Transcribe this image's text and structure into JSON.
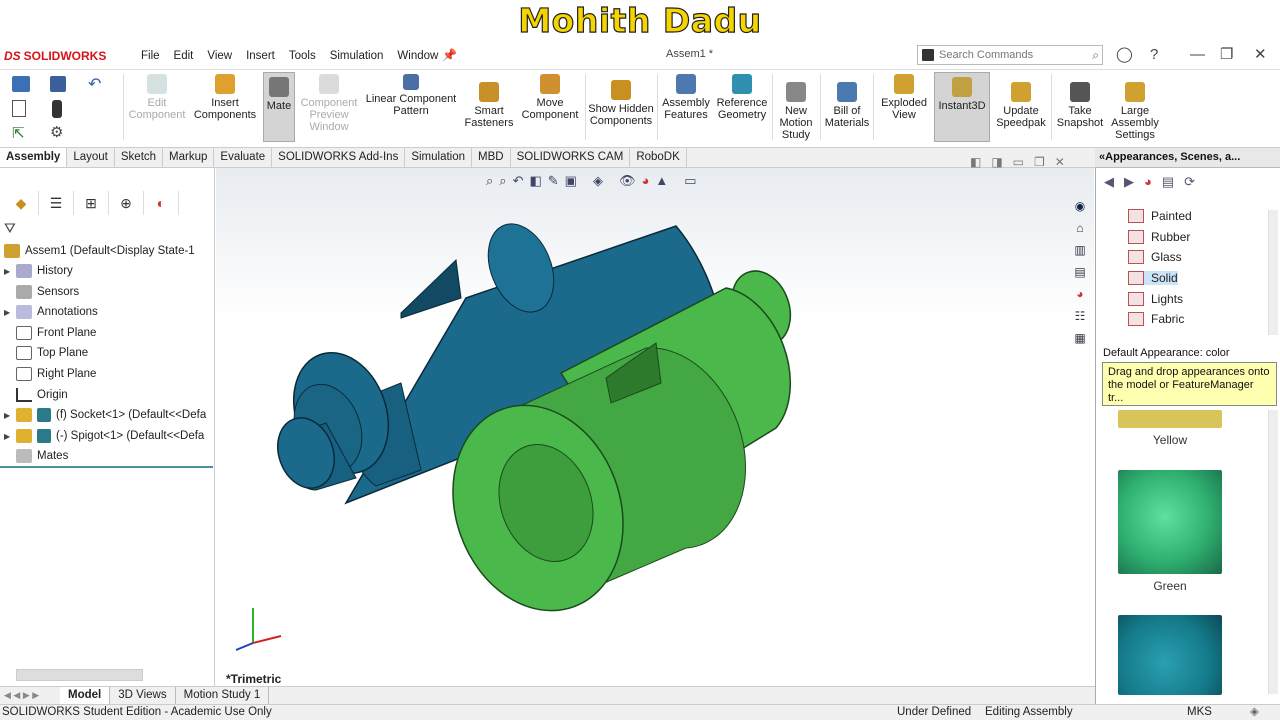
{
  "banner": {
    "text": "Mohith Dadu"
  },
  "app": {
    "logo_text": "SOLIDWORKS",
    "doc_title": "Assem1 *"
  },
  "menu": [
    "File",
    "Edit",
    "View",
    "Insert",
    "Tools",
    "Simulation",
    "Window"
  ],
  "search": {
    "placeholder": "Search Commands"
  },
  "ribbon": {
    "edit_component": "Edit Component",
    "insert_components": "Insert Components",
    "mate": "Mate",
    "component_preview": "Component Preview Window",
    "linear_pattern": "Linear Component Pattern",
    "smart_fasteners": "Smart Fasteners",
    "move_component": "Move Component",
    "show_hidden": "Show Hidden Components",
    "assembly_features": "Assembly Features",
    "reference_geometry": "Reference Geometry",
    "new_motion_study": "New Motion Study",
    "bill_of_materials": "Bill of Materials",
    "exploded_view": "Exploded View",
    "instant3d": "Instant3D",
    "update_speedpak": "Update Speedpak",
    "take_snapshot": "Take Snapshot",
    "large_assembly": "Large Assembly Settings"
  },
  "command_tabs": [
    "Assembly",
    "Layout",
    "Sketch",
    "Markup",
    "Evaluate",
    "SOLIDWORKS Add-Ins",
    "Simulation",
    "MBD",
    "SOLIDWORKS CAM",
    "RoboDK"
  ],
  "tree": {
    "root": "Assem1  (Default<Display State-1",
    "history": "History",
    "sensors": "Sensors",
    "annotations": "Annotations",
    "front_plane": "Front Plane",
    "top_plane": "Top Plane",
    "right_plane": "Right Plane",
    "origin": "Origin",
    "socket": "(f) Socket<1> (Default<<Defa",
    "spigot": "(-) Spigot<1> (Default<<Defa",
    "mates": "Mates"
  },
  "viewport": {
    "view_label": "*Trimetric"
  },
  "right_panel": {
    "header": "Appearances, Scenes, a...",
    "folders": [
      "Painted",
      "Rubber",
      "Glass",
      "Solid",
      "Lights",
      "Fabric"
    ],
    "selected_folder": "Solid",
    "default_appearance": "Default Appearance: color",
    "tooltip": "Drag and drop appearances onto the model or FeatureManager tr...",
    "swatches": [
      "Yellow",
      "Green"
    ]
  },
  "bottom_tabs": [
    "Model",
    "3D Views",
    "Motion Study 1"
  ],
  "status": {
    "edition": "SOLIDWORKS Student Edition - Academic Use Only",
    "state": "Under Defined",
    "mode": "Editing Assembly",
    "units": "MKS"
  },
  "colors": {
    "socket": "#1b6a8c",
    "spigot": "#4bb84b",
    "accent": "#d7141a"
  }
}
